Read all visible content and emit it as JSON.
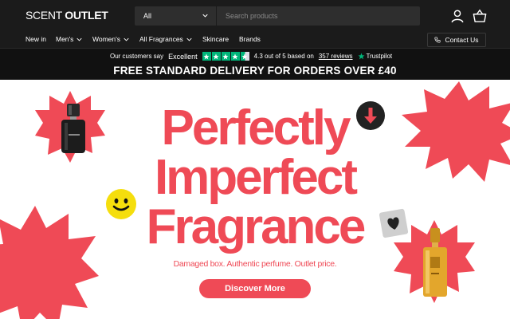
{
  "header": {
    "logo_part1": "SCENT",
    "logo_part2": "OUTLET",
    "category_select": "All",
    "search_placeholder": "Search products",
    "account_icon": "user-icon",
    "basket_icon": "basket-icon"
  },
  "nav": {
    "items": [
      {
        "label": "New in"
      },
      {
        "label": "Men's"
      },
      {
        "label": "Women's"
      },
      {
        "label": "All Fragrances"
      },
      {
        "label": "Skincare"
      },
      {
        "label": "Brands"
      }
    ],
    "contact_label": "Contact Us"
  },
  "trust": {
    "intro": "Our customers say",
    "rating_word": "Excellent",
    "score_text": "4.3 out of 5 based on",
    "reviews_link": "357 reviews",
    "brand": "Trustpilot",
    "stars_filled": 4.5,
    "star_color": "#00b67a"
  },
  "delivery_banner": "FREE STANDARD DELIVERY FOR ORDERS OVER £40",
  "hero": {
    "line1": "Perfectly",
    "line2": "Imperfect",
    "line3": "Fragrance",
    "tagline": "Damaged box. Authentic perfume. Outlet price.",
    "cta": "Discover More",
    "accent_color": "#ef4a56"
  }
}
